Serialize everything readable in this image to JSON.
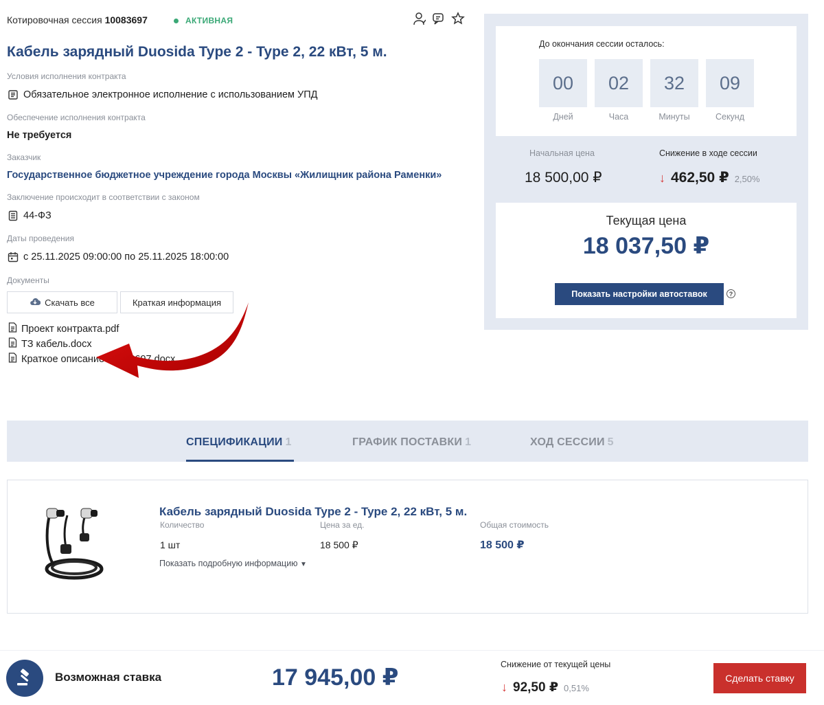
{
  "header": {
    "session_prefix": "Котировочная сессия",
    "session_number": "10083697",
    "status": "АКТИВНАЯ",
    "icons": [
      "user-icon",
      "chat-icon",
      "star-icon"
    ]
  },
  "title": "Кабель зарядный Duosida Type 2 - Type 2, 22 кВт, 5 м.",
  "details": {
    "contract_terms_label": "Условия исполнения контракта",
    "contract_terms_value": "Обязательное электронное исполнение с использованием УПД",
    "security_label": "Обеспечение исполнения контракта",
    "security_value": "Не требуется",
    "customer_label": "Заказчик",
    "customer_value": "Государственное бюджетное учреждение города Москвы «Жилищник района Раменки»",
    "law_label": "Заключение происходит в соответствии с законом",
    "law_value": "44-ФЗ",
    "dates_label": "Даты проведения",
    "dates_value": "с 25.11.2025 09:00:00 по 25.11.2025 18:00:00",
    "documents_label": "Документы"
  },
  "documents": {
    "download_all": "Скачать все",
    "brief_info": "Краткая информация",
    "files": [
      "Проект контракта.pdf",
      "ТЗ кабель.docx",
      "Краткое описание 10083697.docx"
    ]
  },
  "timer": {
    "caption": "До окончания сессии осталось:",
    "cells": [
      {
        "value": "00",
        "label": "Дней"
      },
      {
        "value": "02",
        "label": "Часа"
      },
      {
        "value": "32",
        "label": "Минуты"
      },
      {
        "value": "09",
        "label": "Секунд"
      }
    ]
  },
  "prices": {
    "start_label": "Начальная цена",
    "start_value": "18 500,00 ₽",
    "decrease_label": "Снижение в ходе сессии",
    "decrease_value": "462,50 ₽",
    "decrease_pct": "2,50%",
    "current_label": "Текущая цена",
    "current_value": "18 037,50 ₽",
    "autobid_button": "Показать настройки автоставок"
  },
  "tabs": [
    {
      "label": "СПЕЦИФИКАЦИИ",
      "count": "1",
      "active": true
    },
    {
      "label": "ГРАФИК ПОСТАВКИ",
      "count": "1",
      "active": false
    },
    {
      "label": "ХОД СЕССИИ",
      "count": "5",
      "active": false
    }
  ],
  "product": {
    "title": "Кабель зарядный Duosida Type 2 - Type 2, 22 кВт, 5 м.",
    "qty_label": "Количество",
    "qty_value": "1 шт",
    "unit_price_label": "Цена за ед.",
    "unit_price_value": "18 500 ₽",
    "total_label": "Общая стоимость",
    "total_value": "18 500 ₽",
    "more_link": "Показать подробную информацию"
  },
  "bottom": {
    "bid_label": "Возможная ставка",
    "bid_value": "17 945,00 ₽",
    "decrease_label": "Снижение от текущей цены",
    "decrease_value": "92,50 ₽",
    "decrease_pct": "0,51%",
    "make_bid": "Сделать ставку"
  },
  "colors": {
    "accent": "#2a4a7f",
    "panel_bg": "#e4e9f2",
    "status_green": "#3aa876",
    "danger": "#c9302c"
  }
}
